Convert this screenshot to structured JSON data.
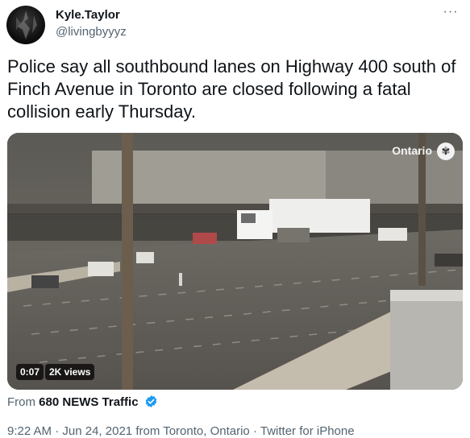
{
  "author": {
    "name": "Kyle.Taylor",
    "handle": "@livingbyyyz"
  },
  "more_icon": "more-dots-icon",
  "tweet_text": "Police say all southbound lanes on Highway 400 south of Finch Avenue in Toronto are closed following a fatal collision early Thursday.",
  "video": {
    "watermark": "Ontario",
    "watermark_logo_icon": "ontario-trillium-logo",
    "duration": "0:07",
    "views": "2K views"
  },
  "source": {
    "prefix": "From",
    "name": "680 NEWS Traffic",
    "verified_icon": "verified-badge-icon"
  },
  "meta": {
    "time": "9:22 AM",
    "sep1": "·",
    "date": "Jun 24, 2021",
    "location_prefix": "from",
    "location": "Toronto, Ontario",
    "sep2": "·",
    "client": "Twitter for iPhone"
  },
  "colors": {
    "text_primary": "#0f1419",
    "text_secondary": "#536471",
    "verified_blue": "#1d9bf0"
  }
}
